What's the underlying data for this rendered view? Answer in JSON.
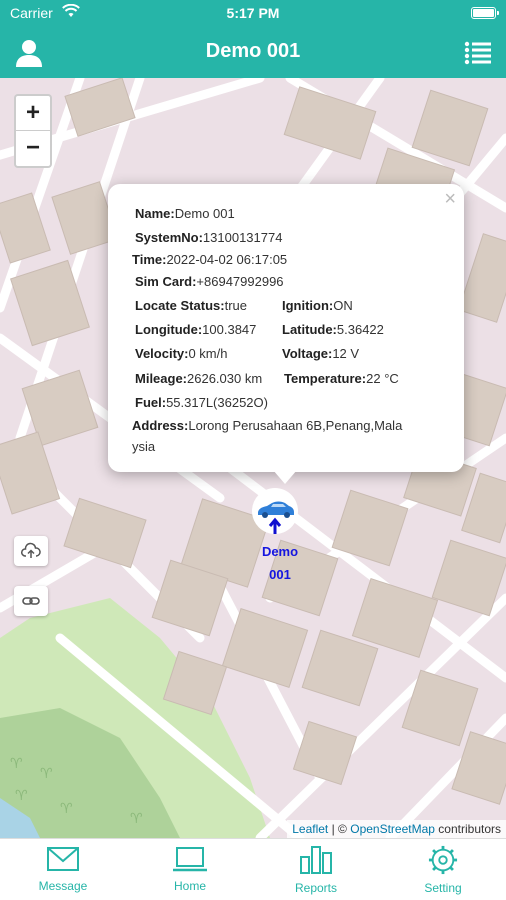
{
  "status_bar": {
    "carrier": "Carrier",
    "time": "5:17 PM"
  },
  "nav": {
    "title": "Demo 001",
    "left_icon": "user-icon",
    "right_icon": "list-icon"
  },
  "map": {
    "zoom_in": "+",
    "zoom_out": "−",
    "side_buttons": [
      "cloud-upload-icon",
      "link-icon"
    ],
    "marker_label_line1": "Demo",
    "marker_label_line2": "001",
    "attribution": {
      "leaflet": "Leaflet",
      "sep": "| ©",
      "osm": "OpenStreetMap",
      "rest": "contributors"
    }
  },
  "popup": {
    "close": "×",
    "name": {
      "k": "Name:",
      "v": "Demo 001"
    },
    "system_no": {
      "k": "SystemNo:",
      "v": "13100131774"
    },
    "time": {
      "k": "Time:",
      "v": "2022-04-02 06:17:05"
    },
    "sim_card": {
      "k": "Sim Card:",
      "v": "+86947992996"
    },
    "locate_status": {
      "k": "Locate Status:",
      "v": "true"
    },
    "ignition": {
      "k": "Ignition:",
      "v": "ON"
    },
    "longitude": {
      "k": "Longitude:",
      "v": "100.3847"
    },
    "latitude": {
      "k": "Latitude:",
      "v": "5.36422"
    },
    "velocity": {
      "k": "Velocity:",
      "v": "0 km/h"
    },
    "voltage": {
      "k": "Voltage:",
      "v": "12 V"
    },
    "mileage": {
      "k": "Mileage:",
      "v": "2626.030 km"
    },
    "temperature": {
      "k": "Temperature:",
      "v": "22 °C"
    },
    "fuel": {
      "k": "Fuel:",
      "v": "55.317L(36252O)"
    },
    "address": {
      "k": "Address:",
      "v1": "Lorong Perusahaan 6B,Penang,Mala",
      "v2": "ysia"
    }
  },
  "tabs": [
    {
      "label": "Message",
      "icon": "mail-icon"
    },
    {
      "label": "Home",
      "icon": "laptop-icon"
    },
    {
      "label": "Reports",
      "icon": "bar-chart-icon"
    },
    {
      "label": "Setting",
      "icon": "gear-icon"
    }
  ],
  "colors": {
    "primary": "#26b5a8",
    "marker_text": "#1515e0",
    "map_bg": "#ece0e6"
  }
}
